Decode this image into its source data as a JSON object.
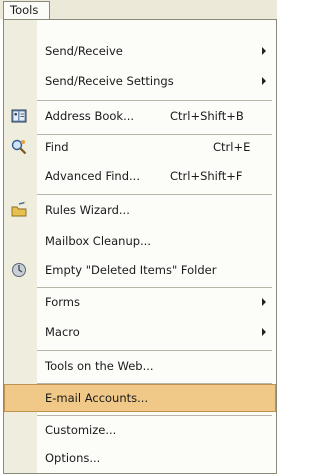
{
  "menubar": {
    "title": "Tools"
  },
  "menu": {
    "items": [
      {
        "label": "Send/Receive",
        "shortcut": "",
        "submenu": true,
        "icon": ""
      },
      {
        "label": "Send/Receive Settings",
        "shortcut": "",
        "submenu": true,
        "icon": ""
      },
      {
        "label": "Address Book...",
        "shortcut": "Ctrl+Shift+B",
        "submenu": false,
        "icon": "address-book-icon"
      },
      {
        "label": "Find",
        "shortcut": "Ctrl+E",
        "submenu": false,
        "icon": "find-icon"
      },
      {
        "label": "Advanced Find...",
        "shortcut": "Ctrl+Shift+F",
        "submenu": false,
        "icon": ""
      },
      {
        "label": "Rules Wizard...",
        "shortcut": "",
        "submenu": false,
        "icon": "rules-wizard-icon"
      },
      {
        "label": "Mailbox Cleanup...",
        "shortcut": "",
        "submenu": false,
        "icon": ""
      },
      {
        "label": "Empty \"Deleted Items\" Folder",
        "shortcut": "",
        "submenu": false,
        "icon": "empty-deleted-icon"
      },
      {
        "label": "Forms",
        "shortcut": "",
        "submenu": true,
        "icon": ""
      },
      {
        "label": "Macro",
        "shortcut": "",
        "submenu": true,
        "icon": ""
      },
      {
        "label": "Tools on the Web...",
        "shortcut": "",
        "submenu": false,
        "icon": ""
      },
      {
        "label": "E-mail Accounts...",
        "shortcut": "",
        "submenu": false,
        "icon": "",
        "highlighted": true
      },
      {
        "label": "Customize...",
        "shortcut": "",
        "submenu": false,
        "icon": ""
      },
      {
        "label": "Options...",
        "shortcut": "",
        "submenu": false,
        "icon": ""
      }
    ]
  },
  "colors": {
    "highlight": "#f0c887",
    "highlight_border": "#c0914e",
    "icon_strip": "#efedde"
  }
}
